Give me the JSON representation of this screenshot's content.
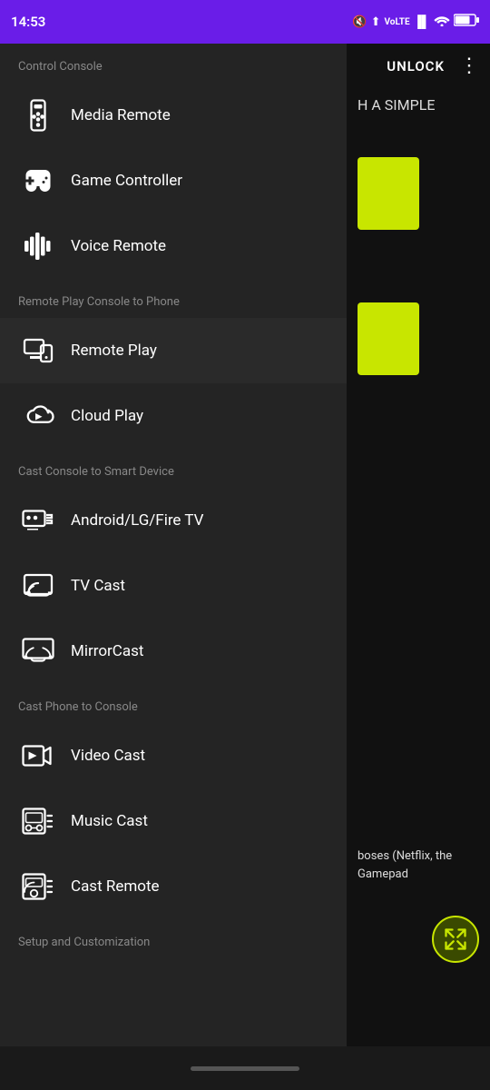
{
  "statusBar": {
    "time": "14:53",
    "batteryLevel": "70"
  },
  "sidebar": {
    "sections": [
      {
        "id": "control-console",
        "header": "Control Console",
        "items": [
          {
            "id": "media-remote",
            "label": "Media Remote",
            "icon": "media-remote-icon"
          },
          {
            "id": "game-controller",
            "label": "Game Controller",
            "icon": "game-controller-icon"
          },
          {
            "id": "voice-remote",
            "label": "Voice Remote",
            "icon": "voice-remote-icon"
          }
        ]
      },
      {
        "id": "remote-play-section",
        "header": "Remote Play Console to Phone",
        "items": [
          {
            "id": "remote-play",
            "label": "Remote Play",
            "icon": "remote-play-icon",
            "active": true
          },
          {
            "id": "cloud-play",
            "label": "Cloud Play",
            "icon": "cloud-play-icon"
          }
        ]
      },
      {
        "id": "cast-console-section",
        "header": "Cast Console to Smart Device",
        "items": [
          {
            "id": "android-lg-fire",
            "label": "Android/LG/Fire TV",
            "icon": "android-tv-icon"
          },
          {
            "id": "tv-cast",
            "label": "TV Cast",
            "icon": "tv-cast-icon"
          },
          {
            "id": "mirrorcast",
            "label": "MirrorCast",
            "icon": "mirrorcast-icon"
          }
        ]
      },
      {
        "id": "cast-phone-section",
        "header": "Cast Phone to Console",
        "items": [
          {
            "id": "video-cast",
            "label": "Video Cast",
            "icon": "video-cast-icon"
          },
          {
            "id": "music-cast",
            "label": "Music Cast",
            "icon": "music-cast-icon"
          },
          {
            "id": "cast-remote",
            "label": "Cast Remote",
            "icon": "cast-remote-icon"
          }
        ]
      },
      {
        "id": "setup-section",
        "header": "Setup and Customization",
        "items": []
      }
    ]
  },
  "mainPanel": {
    "unlockLabel": "UNLOCK",
    "subtitleText": "H A SIMPLE",
    "bottomText": "boses (Netflix,\nthe Gamepad"
  }
}
